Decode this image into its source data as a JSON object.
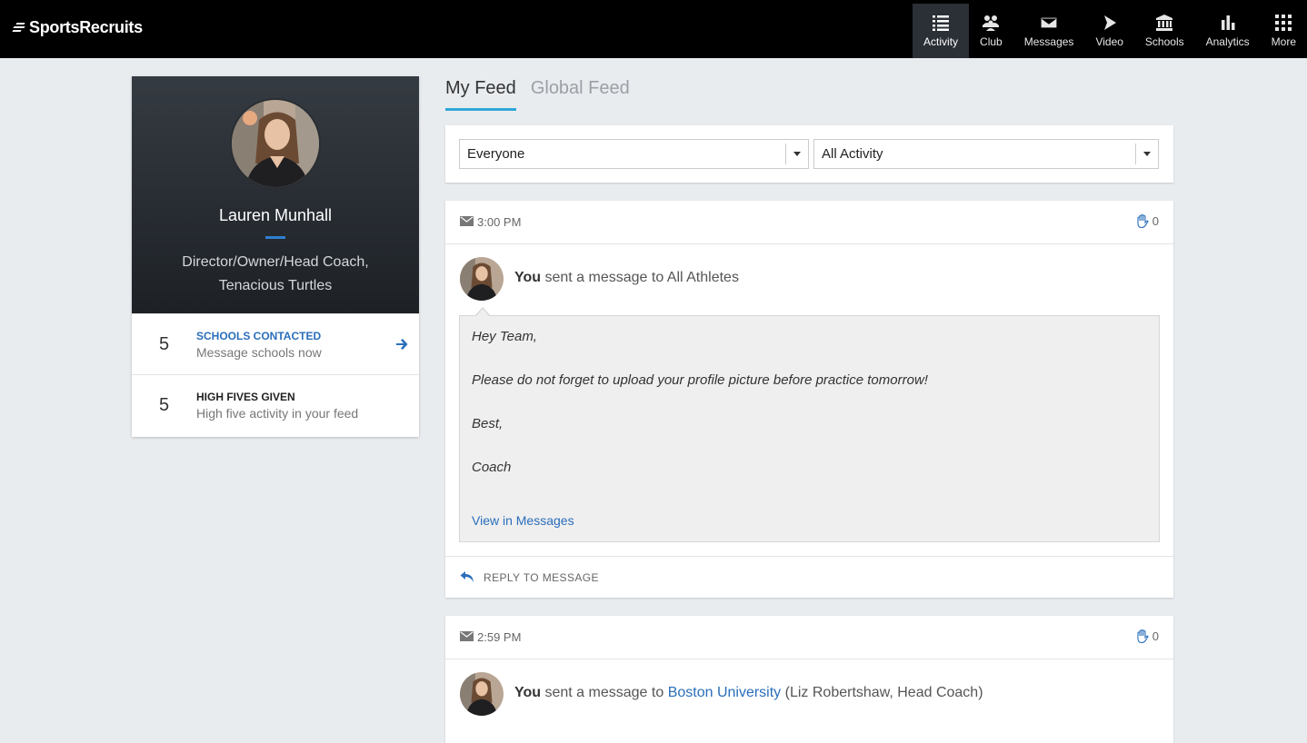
{
  "brand": {
    "name": "SportsRecruits"
  },
  "nav": {
    "items": [
      {
        "label": "Activity",
        "icon": "list-icon"
      },
      {
        "label": "Club",
        "icon": "group-icon"
      },
      {
        "label": "Messages",
        "icon": "envelope-icon"
      },
      {
        "label": "Video",
        "icon": "play-icon"
      },
      {
        "label": "Schools",
        "icon": "school-icon"
      },
      {
        "label": "Analytics",
        "icon": "bar-chart-icon"
      },
      {
        "label": "More",
        "icon": "grid-icon"
      }
    ],
    "active": "Activity"
  },
  "profile": {
    "name": "Lauren Munhall",
    "title_line1": "Director/Owner/Head Coach,",
    "title_line2": "Tenacious Turtles",
    "stats": [
      {
        "count": "5",
        "label": "SCHOOLS CONTACTED",
        "sub": "Message schools now"
      },
      {
        "count": "5",
        "label": "HIGH FIVES GIVEN",
        "sub": "High five activity in your feed"
      }
    ]
  },
  "feed": {
    "tabs": [
      "My Feed",
      "Global Feed"
    ],
    "filters": {
      "audience": "Everyone",
      "activity": "All Activity"
    },
    "items": [
      {
        "time": "3:00 PM",
        "high_fives": "0",
        "actor": "You",
        "action": "sent a message to All Athletes",
        "body": [
          "Hey Team,",
          "Please do not forget to upload your profile picture before practice tomorrow!",
          "Best,",
          "Coach"
        ],
        "view_link": "View in Messages",
        "reply": "REPLY TO MESSAGE"
      },
      {
        "time": "2:59 PM",
        "high_fives": "0",
        "actor": "You",
        "action_prefix": "sent a message to",
        "recipient": "Boston University",
        "recipient_detail": "(Liz Robertshaw, Head Coach)"
      }
    ]
  },
  "colors": {
    "accent_blue": "#2a6ebb",
    "tab_underline": "#2fa8d8",
    "topbar": "#000000"
  }
}
